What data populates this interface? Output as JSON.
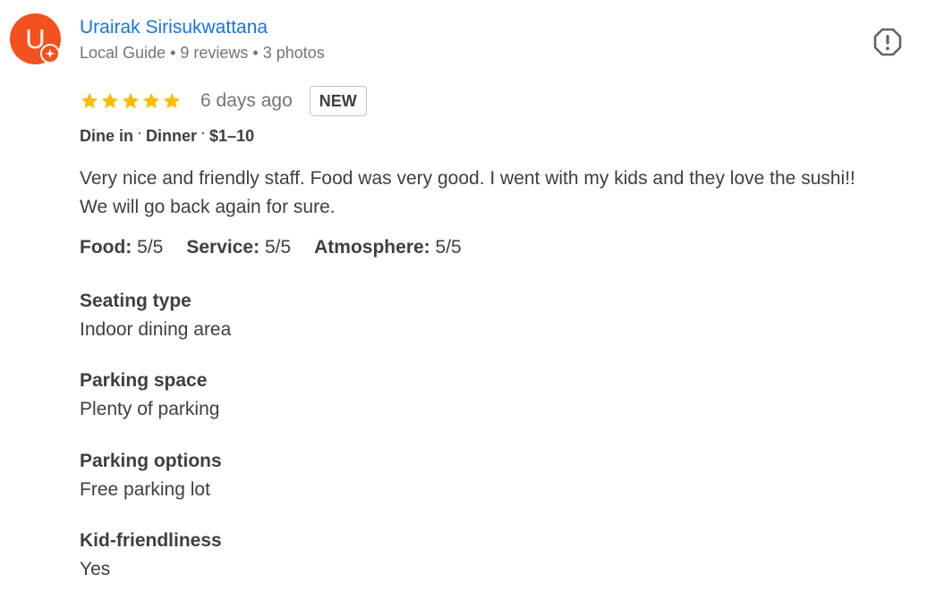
{
  "author": {
    "initial": "U",
    "name": "Urairak Sirisukwattana",
    "role": "Local Guide",
    "reviews": "9 reviews",
    "photos": "3 photos",
    "avatar_color": "#f4511e"
  },
  "icons": {
    "report": "report-octagon-icon",
    "star": "star-icon",
    "local_guide": "local-guide-badge-icon"
  },
  "review": {
    "rating": 5,
    "rating_max": 5,
    "star_color": "#fbbc04",
    "date": "6 days ago",
    "badge": "NEW",
    "context": [
      "Dine in",
      "Dinner",
      "$1–10"
    ],
    "text": "Very nice and friendly staff. Food was very good. I went with my kids and they love the sushi!! We will go back again for sure.",
    "subratings": [
      {
        "label": "Food:",
        "value": "5/5"
      },
      {
        "label": "Service:",
        "value": "5/5"
      },
      {
        "label": "Atmosphere:",
        "value": "5/5"
      }
    ],
    "attributes": [
      {
        "label": "Seating type",
        "value": "Indoor dining area"
      },
      {
        "label": "Parking space",
        "value": "Plenty of parking"
      },
      {
        "label": "Parking options",
        "value": "Free parking lot"
      },
      {
        "label": "Kid-friendliness",
        "value": "Yes"
      }
    ]
  }
}
